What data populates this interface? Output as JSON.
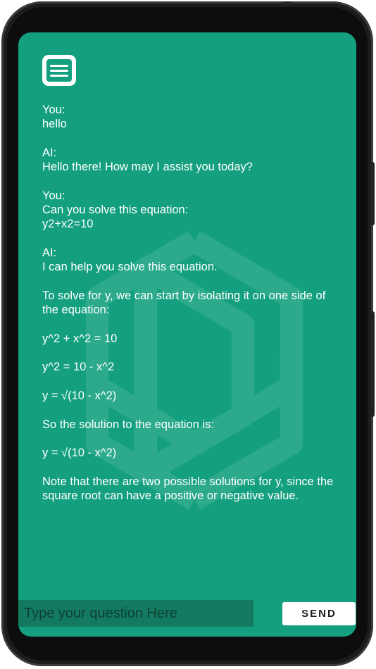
{
  "chat": {
    "messages": [
      {
        "sender": "You:",
        "lines": [
          "hello"
        ]
      },
      {
        "sender": "AI:",
        "lines": [
          "Hello there! How may I assist you today?"
        ]
      },
      {
        "sender": "You:",
        "lines": [
          "Can you solve this equation:\ny2+x2=10"
        ]
      },
      {
        "sender": "AI:",
        "lines": [
          "I can help you solve this equation.",
          "To solve for y, we can start by isolating it on one side of the equation:",
          "y^2 + x^2 = 10",
          "y^2 = 10 - x^2",
          "y = √(10 - x^2)",
          "So the solution to the equation is:",
          "y = √(10 - x^2)",
          "Note that there are two possible solutions for y, since the square root can have a positive or negative value."
        ]
      }
    ]
  },
  "composer": {
    "placeholder": "Type your question Here",
    "send_label": "SEND"
  },
  "icons": {
    "menu": "menu-icon",
    "watermark": "openai-logo-icon"
  },
  "colors": {
    "background": "#14a07e",
    "input": "#137a60",
    "text": "#ffffff"
  }
}
